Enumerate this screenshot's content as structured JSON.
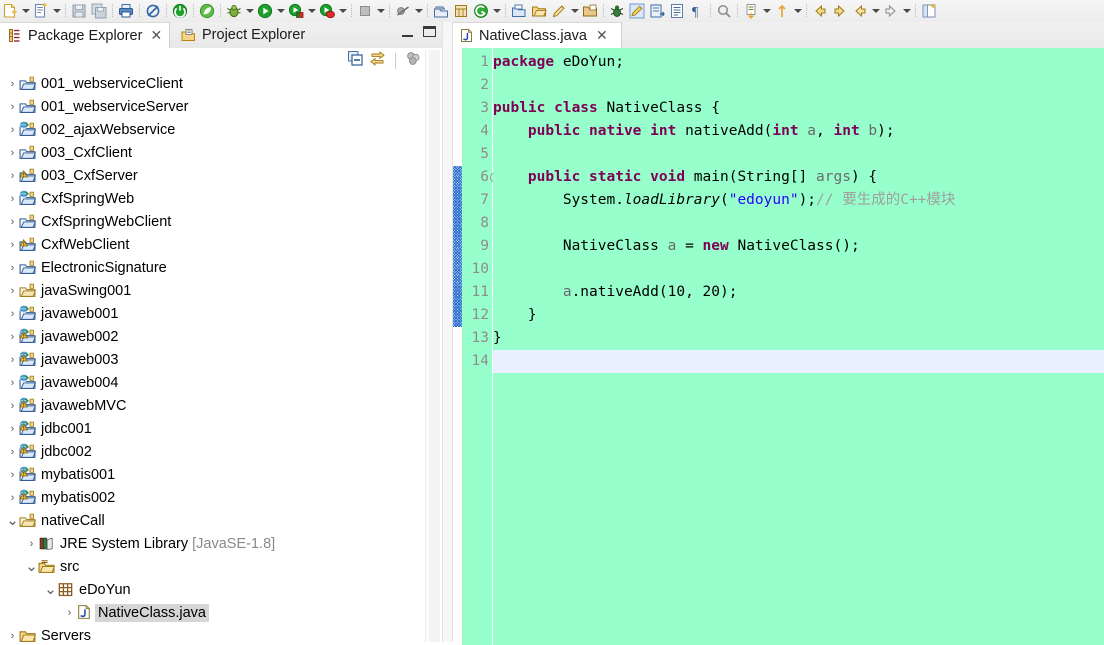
{
  "toolbar": {
    "groups": [
      {
        "buttons": [
          {
            "name": "new-wizard",
            "icon": "new-file-icon",
            "arrow": true
          },
          {
            "name": "new-java-class",
            "icon": "new-class-icon",
            "arrow": true
          }
        ]
      },
      {
        "buttons": [
          {
            "name": "save",
            "icon": "save-icon",
            "arrow": false
          },
          {
            "name": "save-all",
            "icon": "save-all-icon",
            "arrow": false
          }
        ]
      },
      {
        "buttons": [
          {
            "name": "print",
            "icon": "print-icon",
            "arrow": false
          }
        ]
      },
      {
        "buttons": [
          {
            "name": "toggle-mark-occurrences",
            "icon": "mark-occurrences-icon",
            "arrow": false
          }
        ]
      },
      {
        "buttons": [
          {
            "name": "spring-boot-dashboard",
            "icon": "spring-power-icon",
            "arrow": false
          }
        ]
      },
      {
        "buttons": [
          {
            "name": "spring-leaf",
            "icon": "spring-leaf-icon",
            "arrow": false
          }
        ]
      },
      {
        "buttons": [
          {
            "name": "debug",
            "icon": "debug-bug-icon",
            "arrow": true
          },
          {
            "name": "run",
            "icon": "run-play-icon",
            "arrow": true
          },
          {
            "name": "run-external-tools",
            "icon": "external-tools-icon",
            "arrow": true
          },
          {
            "name": "coverage",
            "icon": "coverage-icon",
            "arrow": true
          }
        ]
      },
      {
        "buttons": [
          {
            "name": "terminate",
            "icon": "stop-icon",
            "arrow": true
          }
        ]
      },
      {
        "buttons": [
          {
            "name": "skip-breakpoints",
            "icon": "skip-breakpoints-icon",
            "arrow": true
          }
        ]
      },
      {
        "buttons": [
          {
            "name": "new-package",
            "icon": "new-package-icon",
            "arrow": false
          },
          {
            "name": "new-java-project",
            "icon": "new-project-icon",
            "arrow": false
          },
          {
            "name": "new-spring-element",
            "icon": "spring-green-icon",
            "arrow": true
          }
        ]
      },
      {
        "buttons": [
          {
            "name": "open-type",
            "icon": "open-type-icon",
            "arrow": false
          },
          {
            "name": "open-task",
            "icon": "open-folder-icon",
            "arrow": false
          },
          {
            "name": "search",
            "icon": "pencil-search-icon",
            "arrow": true
          },
          {
            "name": "open-resource",
            "icon": "open-resource-icon",
            "arrow": false
          }
        ]
      },
      {
        "buttons": [
          {
            "name": "toggle-ant-build",
            "icon": "ant-icon",
            "arrow": false
          },
          {
            "name": "toggle-highlight",
            "icon": "highlight-pen-icon",
            "arrow": false
          },
          {
            "name": "next-annotation-nav",
            "icon": "next-annotation-icon",
            "arrow": false
          },
          {
            "name": "show-whitespace",
            "icon": "show-whitespace-icon",
            "arrow": false
          },
          {
            "name": "pilcrow",
            "icon": "pilcrow-icon",
            "arrow": false
          }
        ]
      },
      {
        "buttons": [
          {
            "name": "search-reference",
            "icon": "search-ref-icon",
            "arrow": false
          }
        ]
      },
      {
        "buttons": [
          {
            "name": "next-annotation",
            "icon": "next-marker-icon",
            "arrow": true
          },
          {
            "name": "previous-annotation",
            "icon": "previous-marker-icon",
            "arrow": true
          }
        ]
      },
      {
        "buttons": [
          {
            "name": "back",
            "icon": "back-arrow-icon",
            "arrow": false
          },
          {
            "name": "forward",
            "icon": "forward-arrow-icon",
            "arrow": false
          },
          {
            "name": "back-history",
            "icon": "back-history-icon",
            "arrow": true
          },
          {
            "name": "forward-history",
            "icon": "forward-history-icon",
            "arrow": true
          }
        ]
      },
      {
        "buttons": [
          {
            "name": "open-perspective",
            "icon": "open-perspective-icon",
            "arrow": false
          }
        ]
      }
    ]
  },
  "left_view": {
    "tabs": [
      {
        "label": "Package Explorer",
        "icon": "package-explorer-icon",
        "active": true,
        "closable": true
      },
      {
        "label": "Project Explorer",
        "icon": "project-explorer-icon",
        "active": false,
        "closable": false
      }
    ],
    "window_buttons": [
      {
        "name": "minimize-view-button",
        "icon": "minimize-icon"
      },
      {
        "name": "maximize-view-button",
        "icon": "maximize-icon"
      }
    ],
    "view_toolbar": [
      {
        "name": "collapse-all-button",
        "icon": "collapse-all-icon"
      },
      {
        "name": "link-with-editor-button",
        "icon": "link-with-editor-icon"
      },
      {
        "name": "focus-on-active-task-button",
        "icon": "focus-active-task-icon"
      },
      {
        "name": "view-menu-button",
        "icon": "view-menu-icon"
      }
    ],
    "tree": [
      {
        "label": "001_webserviceClient",
        "indent": 0,
        "twisty": "collapsed",
        "icon": "java-web-project",
        "selected": false
      },
      {
        "label": "001_webserviceServer",
        "indent": 0,
        "twisty": "collapsed",
        "icon": "java-web-project",
        "selected": false
      },
      {
        "label": "002_ajaxWebservice",
        "indent": 0,
        "twisty": "collapsed",
        "icon": "dynamic-web-project",
        "selected": false
      },
      {
        "label": "003_CxfClient",
        "indent": 0,
        "twisty": "collapsed",
        "icon": "java-web-project",
        "selected": false
      },
      {
        "label": "003_CxfServer",
        "indent": 0,
        "twisty": "collapsed",
        "icon": "warning-web-project",
        "selected": false
      },
      {
        "label": "CxfSpringWeb",
        "indent": 0,
        "twisty": "collapsed",
        "icon": "dynamic-web-project",
        "selected": false
      },
      {
        "label": "CxfSpringWebClient",
        "indent": 0,
        "twisty": "collapsed",
        "icon": "java-web-project",
        "selected": false
      },
      {
        "label": "CxfWebClient",
        "indent": 0,
        "twisty": "collapsed",
        "icon": "warning-web-project",
        "selected": false
      },
      {
        "label": "ElectronicSignature",
        "indent": 0,
        "twisty": "collapsed",
        "icon": "java-web-project",
        "selected": false
      },
      {
        "label": "javaSwing001",
        "indent": 0,
        "twisty": "collapsed",
        "icon": "java-project",
        "selected": false
      },
      {
        "label": "javaweb001",
        "indent": 0,
        "twisty": "collapsed",
        "icon": "dynamic-web-project",
        "selected": false
      },
      {
        "label": "javaweb002",
        "indent": 0,
        "twisty": "collapsed",
        "icon": "warning-dynamic-web-project",
        "selected": false
      },
      {
        "label": "javaweb003",
        "indent": 0,
        "twisty": "collapsed",
        "icon": "warning-dynamic-web-project",
        "selected": false
      },
      {
        "label": "javaweb004",
        "indent": 0,
        "twisty": "collapsed",
        "icon": "dynamic-web-project",
        "selected": false
      },
      {
        "label": "javawebMVC",
        "indent": 0,
        "twisty": "collapsed",
        "icon": "warning-dynamic-web-project",
        "selected": false
      },
      {
        "label": "jdbc001",
        "indent": 0,
        "twisty": "collapsed",
        "icon": "warning-dynamic-web-project",
        "selected": false
      },
      {
        "label": "jdbc002",
        "indent": 0,
        "twisty": "collapsed",
        "icon": "warning-dynamic-web-project",
        "selected": false
      },
      {
        "label": "mybatis001",
        "indent": 0,
        "twisty": "collapsed",
        "icon": "warning-dynamic-web-project",
        "selected": false
      },
      {
        "label": "mybatis002",
        "indent": 0,
        "twisty": "collapsed",
        "icon": "warning-dynamic-web-project",
        "selected": false
      },
      {
        "label": "nativeCall",
        "indent": 0,
        "twisty": "expanded",
        "icon": "java-project",
        "selected": false
      },
      {
        "label": "JRE System Library",
        "suffix": " [JavaSE-1.8]",
        "indent": 1,
        "twisty": "collapsed",
        "icon": "jre-library-icon",
        "selected": false
      },
      {
        "label": "src",
        "indent": 1,
        "twisty": "expanded",
        "icon": "source-folder-icon",
        "selected": false
      },
      {
        "label": "eDoYun",
        "indent": 2,
        "twisty": "expanded",
        "icon": "package-icon",
        "selected": false
      },
      {
        "label": "NativeClass.java",
        "indent": 3,
        "twisty": "collapsed",
        "icon": "java-file-icon",
        "selected": true
      },
      {
        "label": "Servers",
        "indent": 0,
        "twisty": "collapsed",
        "icon": "folder-icon",
        "selected": false
      }
    ]
  },
  "editor": {
    "tab": {
      "label": "NativeClass.java",
      "icon": "java-file-icon",
      "closable": true
    },
    "cursor_line": 14,
    "change_bar_lines": [
      6,
      7,
      8,
      9,
      10,
      11,
      12
    ],
    "fold_lines": [
      6
    ],
    "lines": [
      {
        "n": 1,
        "tokens": [
          {
            "t": "package ",
            "c": "kw"
          },
          {
            "t": "eDoYun;",
            "c": ""
          }
        ]
      },
      {
        "n": 2,
        "tokens": []
      },
      {
        "n": 3,
        "tokens": [
          {
            "t": "public class ",
            "c": "kw"
          },
          {
            "t": "NativeClass {",
            "c": ""
          }
        ]
      },
      {
        "n": 4,
        "tokens": [
          {
            "t": "    ",
            "c": ""
          },
          {
            "t": "public native int ",
            "c": "kw"
          },
          {
            "t": "nativeAdd(",
            "c": ""
          },
          {
            "t": "int ",
            "c": "kw"
          },
          {
            "t": "a",
            "c": "gry"
          },
          {
            "t": ", ",
            "c": ""
          },
          {
            "t": "int ",
            "c": "kw"
          },
          {
            "t": "b",
            "c": "gry"
          },
          {
            "t": ");",
            "c": ""
          }
        ]
      },
      {
        "n": 5,
        "tokens": []
      },
      {
        "n": 6,
        "tokens": [
          {
            "t": "    ",
            "c": ""
          },
          {
            "t": "public static void ",
            "c": "kw"
          },
          {
            "t": "main(String[] ",
            "c": ""
          },
          {
            "t": "args",
            "c": "gry"
          },
          {
            "t": ") {",
            "c": ""
          }
        ]
      },
      {
        "n": 7,
        "tokens": [
          {
            "t": "        System.",
            "c": ""
          },
          {
            "t": "loadLibrary",
            "c": "ital"
          },
          {
            "t": "(",
            "c": ""
          },
          {
            "t": "\"edoyun\"",
            "c": "str"
          },
          {
            "t": ");",
            "c": ""
          },
          {
            "t": "// 要生成的C++模块",
            "c": "cmt"
          }
        ]
      },
      {
        "n": 8,
        "tokens": []
      },
      {
        "n": 9,
        "tokens": [
          {
            "t": "        NativeClass ",
            "c": ""
          },
          {
            "t": "a",
            "c": "gry"
          },
          {
            "t": " = ",
            "c": ""
          },
          {
            "t": "new ",
            "c": "kw"
          },
          {
            "t": "NativeClass();",
            "c": ""
          }
        ]
      },
      {
        "n": 10,
        "tokens": []
      },
      {
        "n": 11,
        "tokens": [
          {
            "t": "        ",
            "c": ""
          },
          {
            "t": "a",
            "c": "gry"
          },
          {
            "t": ".nativeAdd(10, 20);",
            "c": ""
          }
        ]
      },
      {
        "n": 12,
        "tokens": [
          {
            "t": "    }",
            "c": ""
          }
        ]
      },
      {
        "n": 13,
        "tokens": [
          {
            "t": "}",
            "c": ""
          }
        ]
      },
      {
        "n": 14,
        "tokens": []
      }
    ]
  },
  "colors": {
    "editor_background": "#97ffcc",
    "cursor_line": "#e8f1fd",
    "keyword": "#7f0055",
    "string": "#2a00ff",
    "comment": "#9f9f9f",
    "line_number": "#8d8d8d",
    "selection": "#d6d6d6"
  }
}
